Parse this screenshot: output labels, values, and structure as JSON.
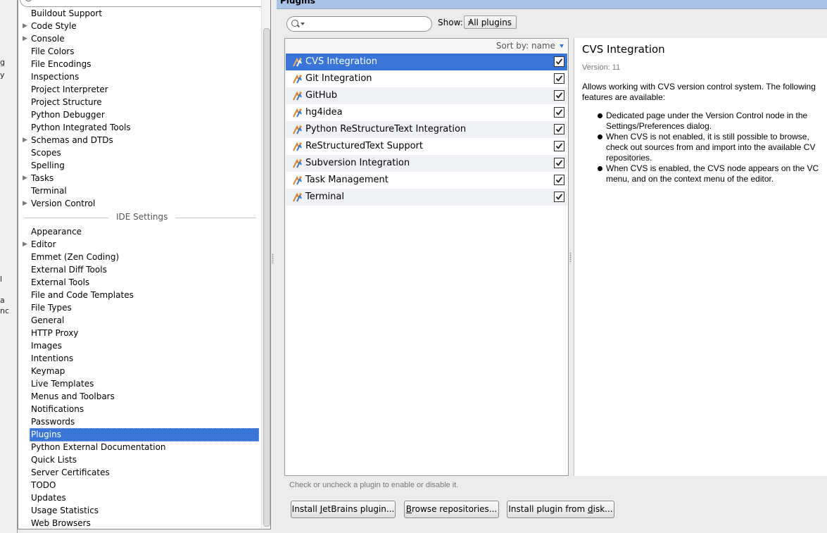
{
  "edge": {
    "fragments": [
      "g",
      "y",
      "l",
      "a",
      "nc"
    ]
  },
  "tree": {
    "project_items": [
      {
        "label": "Buildout Support",
        "arrow": false
      },
      {
        "label": "Code Style",
        "arrow": true
      },
      {
        "label": "Console",
        "arrow": true
      },
      {
        "label": "File Colors",
        "arrow": false
      },
      {
        "label": "File Encodings",
        "arrow": false
      },
      {
        "label": "Inspections",
        "arrow": false
      },
      {
        "label": "Project Interpreter",
        "arrow": false
      },
      {
        "label": "Project Structure",
        "arrow": false
      },
      {
        "label": "Python Debugger",
        "arrow": false
      },
      {
        "label": "Python Integrated Tools",
        "arrow": false
      },
      {
        "label": "Schemas and DTDs",
        "arrow": true
      },
      {
        "label": "Scopes",
        "arrow": false
      },
      {
        "label": "Spelling",
        "arrow": false
      },
      {
        "label": "Tasks",
        "arrow": true
      },
      {
        "label": "Terminal",
        "arrow": false
      },
      {
        "label": "Version Control",
        "arrow": true
      }
    ],
    "ide_settings_label": "IDE Settings",
    "ide_items": [
      {
        "label": "Appearance",
        "arrow": false
      },
      {
        "label": "Editor",
        "arrow": true
      },
      {
        "label": "Emmet (Zen Coding)",
        "arrow": false
      },
      {
        "label": "External Diff Tools",
        "arrow": false
      },
      {
        "label": "External Tools",
        "arrow": false
      },
      {
        "label": "File and Code Templates",
        "arrow": false
      },
      {
        "label": "File Types",
        "arrow": false
      },
      {
        "label": "General",
        "arrow": false
      },
      {
        "label": "HTTP Proxy",
        "arrow": false
      },
      {
        "label": "Images",
        "arrow": false
      },
      {
        "label": "Intentions",
        "arrow": false
      },
      {
        "label": "Keymap",
        "arrow": false
      },
      {
        "label": "Live Templates",
        "arrow": false
      },
      {
        "label": "Menus and Toolbars",
        "arrow": false
      },
      {
        "label": "Notifications",
        "arrow": false
      },
      {
        "label": "Passwords",
        "arrow": false
      },
      {
        "label": "Plugins",
        "arrow": false,
        "selected": true
      },
      {
        "label": "Python External Documentation",
        "arrow": false
      },
      {
        "label": "Quick Lists",
        "arrow": false
      },
      {
        "label": "Server Certificates",
        "arrow": false
      },
      {
        "label": "TODO",
        "arrow": false
      },
      {
        "label": "Updates",
        "arrow": false
      },
      {
        "label": "Usage Statistics",
        "arrow": false
      },
      {
        "label": "Web Browsers",
        "arrow": false
      }
    ]
  },
  "header": {
    "title": "Plugins"
  },
  "filter": {
    "search_value": "",
    "show_label": "Show:",
    "show_value": "All plugins"
  },
  "plugin_list": {
    "sort_label": "Sort by: name",
    "plugins": [
      {
        "name": "CVS Integration",
        "enabled": true,
        "selected": true
      },
      {
        "name": "Git Integration",
        "enabled": true
      },
      {
        "name": "GitHub",
        "enabled": true
      },
      {
        "name": "hg4idea",
        "enabled": true
      },
      {
        "name": "Python ReStructureText Integration",
        "enabled": true
      },
      {
        "name": "ReStructuredText Support",
        "enabled": true
      },
      {
        "name": "Subversion Integration",
        "enabled": true
      },
      {
        "name": "Task Management",
        "enabled": true
      },
      {
        "name": "Terminal",
        "enabled": true
      }
    ]
  },
  "detail": {
    "title": "CVS Integration",
    "version": "Version: 11",
    "description_lines": [
      "Allows working with CVS version control system. The following",
      "features are available:"
    ],
    "bullets": [
      [
        "Dedicated page under the Version Control node in the",
        "Settings/Preferences dialog."
      ],
      [
        "When CVS is not enabled, it is still possible to browse,",
        "check out sources from and import into the available CV",
        "repositories."
      ],
      [
        "When CVS is enabled, the CVS node appears on the VC",
        "menu, and on the context menu of the editor."
      ]
    ]
  },
  "hint": "Check or uncheck a plugin to enable or disable it.",
  "buttons": {
    "install_jetbrains": {
      "pre": "Install ",
      "mn": "J",
      "post": "etBrains plugin..."
    },
    "browse_repos": {
      "pre": "",
      "mn": "B",
      "post": "rowse repositories..."
    },
    "install_disk": {
      "pre": "Install plugin from ",
      "mn": "d",
      "post": "isk..."
    }
  },
  "colors": {
    "selection": "#3875d7",
    "header": "#a8c3e6"
  }
}
